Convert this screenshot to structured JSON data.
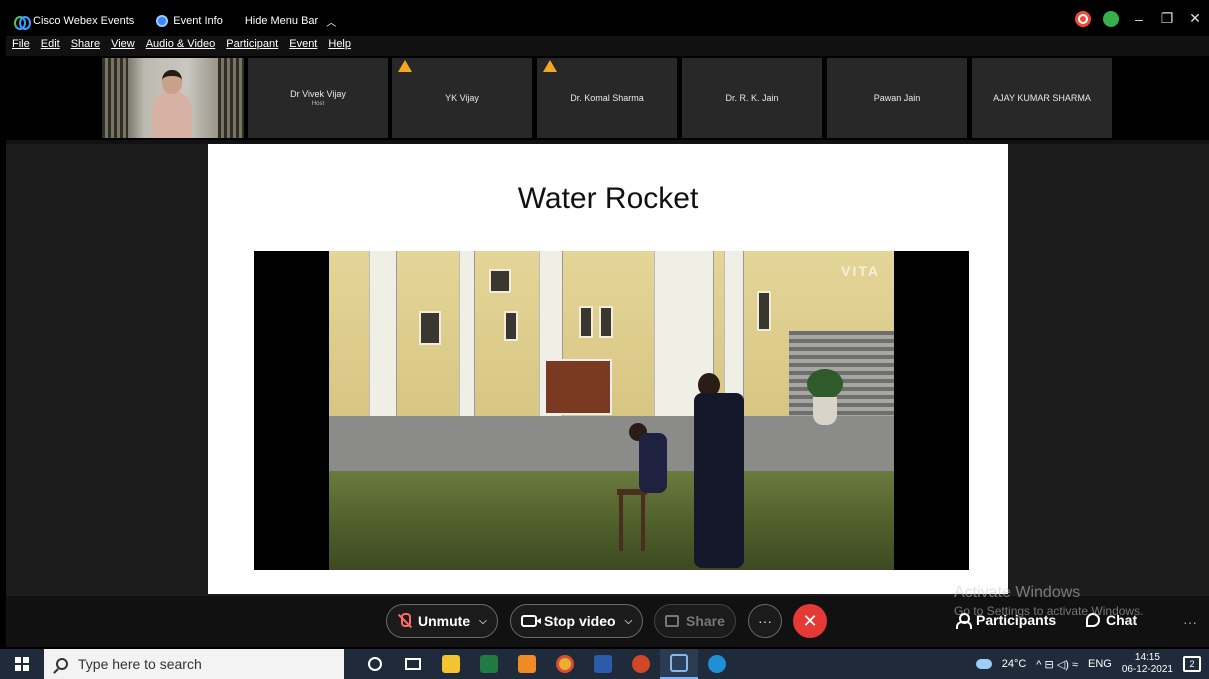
{
  "titlebar": {
    "app_name": "Cisco Webex Events",
    "event_info": "Event Info",
    "hide_menu": "Hide Menu Bar",
    "window_controls": [
      "–",
      "❐",
      "✕"
    ]
  },
  "menubar": [
    "File",
    "Edit",
    "Share",
    "View",
    "Audio & Video",
    "Participant",
    "Event",
    "Help"
  ],
  "participants": [
    {
      "name": "Dr Vivek Vijay",
      "role": "Host",
      "warning": false
    },
    {
      "name": "YK Vijay",
      "role": "",
      "warning": true
    },
    {
      "name": "Dr. Komal Sharma",
      "role": "",
      "warning": true
    },
    {
      "name": "Dr. R. K. Jain",
      "role": "",
      "warning": false
    },
    {
      "name": "Pawan Jain",
      "role": "",
      "warning": false
    },
    {
      "name": "AJAY KUMAR SHARMA",
      "role": "",
      "warning": false
    }
  ],
  "slide": {
    "title": "Water Rocket",
    "video_watermark": "VITA"
  },
  "controls": {
    "unmute": "Unmute",
    "stop_video": "Stop video",
    "share": "Share",
    "more": "···",
    "end": "✕",
    "participants": "Participants",
    "chat": "Chat",
    "overflow": "···"
  },
  "activation_notice": {
    "line1": "Activate Windows",
    "line2": "Go to Settings to activate Windows."
  },
  "taskbar": {
    "search_placeholder": "Type here to search",
    "weather": "24°C",
    "language": "ENG",
    "time": "14:15",
    "date": "06-12-2021",
    "notification_count": "2",
    "tray_symbols": "^ ⊟ ◁) ≈"
  },
  "colors": {
    "end_button": "#e53935",
    "warning": "#f5a623",
    "record": "#f04a3a",
    "network": "#35b04a"
  }
}
